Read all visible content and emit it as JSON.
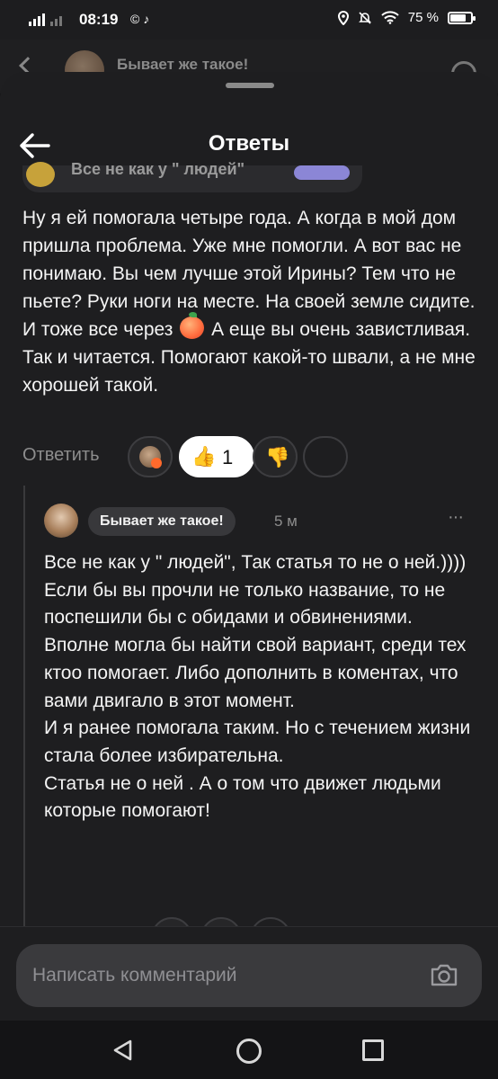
{
  "status_bar": {
    "time": "08:19",
    "apps": "© ♪",
    "battery_text": "75 %",
    "battery_level": 0.75
  },
  "background_page": {
    "title": "Бывает же такое!"
  },
  "sheet": {
    "title": "Ответы"
  },
  "comment": {
    "author_peek": "Все не как у \" людей\"",
    "text_before_emoji": "Ну я ей помогала четыре года. А когда в мой дом пришла проблема. Уже мне помогли. А вот вас не понимаю. Вы чем лучше этой Ирины? Тем что не пьете? Руки ноги на месте. На своей земле сидите. И тоже все через",
    "emoji_icon": "peach-emoji",
    "text_after_emoji": "А еще вы очень завистливая. Так и читается. Помогают какой-то швали, а не мне хорошей такой.",
    "reply_label": "Ответить",
    "like_count": "1"
  },
  "reply": {
    "author": "Бывает же такое!",
    "time": "5 м",
    "more": "···",
    "paragraphs": [
      "Все не как у \" людей\", Так статья то не о ней.)))) Если бы вы прочли не только название, то не поспешили бы с обидами и обвинениями.",
      "Вполне могла бы найти свой вариант, среди тех ктоо помогает. Либо дополнить в коментах, что вами двигало в этот момент.",
      "И я ранее помогала таким. Но с течением жизни стала более избирательна.",
      "Статья не о ней . А о том что движет людьми которые помогают!"
    ]
  },
  "input": {
    "placeholder": "Написать комментарий"
  },
  "colors": {
    "sheet_bg": "#1e1e20",
    "text": "#f4f4f4",
    "muted": "#8d8d8d",
    "input_bg": "#3a3a3d"
  }
}
